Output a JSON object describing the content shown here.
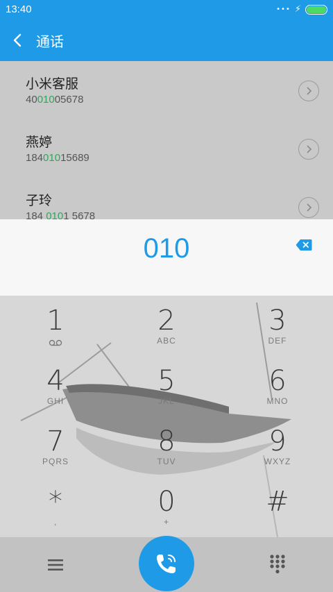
{
  "status_bar": {
    "time": "13:40",
    "dots": "•••",
    "battery_level": 1.0
  },
  "app_bar": {
    "title": "通话"
  },
  "contacts": [
    {
      "name": "小米客服",
      "num_pre": "40",
      "num_match": "010",
      "num_post": "05678"
    },
    {
      "name": "燕婷",
      "num_pre": "184",
      "num_match": "010",
      "num_post": "15689"
    },
    {
      "name": "子玲",
      "num_pre": "184 ",
      "num_match": "010",
      "num_post": "1 5678"
    }
  ],
  "dial_input": {
    "value": "010"
  },
  "keys": [
    {
      "digit": "1",
      "letters": ""
    },
    {
      "digit": "2",
      "letters": "ABC"
    },
    {
      "digit": "3",
      "letters": "DEF"
    },
    {
      "digit": "4",
      "letters": "GHI"
    },
    {
      "digit": "5",
      "letters": "JKL"
    },
    {
      "digit": "6",
      "letters": "MNO"
    },
    {
      "digit": "7",
      "letters": "PQRS"
    },
    {
      "digit": "8",
      "letters": "TUV"
    },
    {
      "digit": "9",
      "letters": "WXYZ"
    },
    {
      "digit": "*",
      "letters": ","
    },
    {
      "digit": "0",
      "letters": "+"
    },
    {
      "digit": "#",
      "letters": ""
    }
  ],
  "icons": {
    "back": "chevron-left-icon",
    "detail": "chevron-right-icon",
    "backspace": "backspace-icon",
    "voicemail": "voicemail-icon",
    "menu": "menu-icon",
    "call": "phone-icon",
    "keypad": "dialpad-icon"
  },
  "colors": {
    "accent": "#1e9ae6",
    "match_highlight": "#2fa65a",
    "battery": "#4cd964"
  }
}
